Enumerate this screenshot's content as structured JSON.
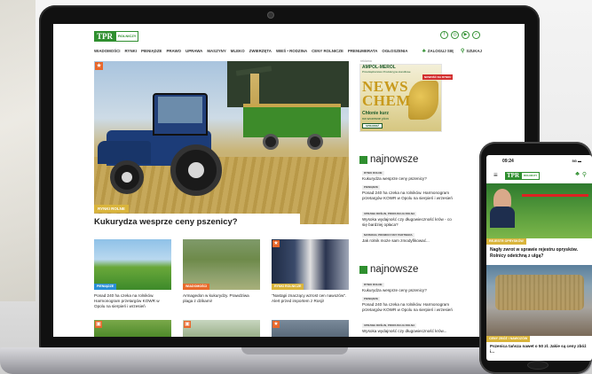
{
  "site": {
    "logo_main": "TPR",
    "logo_sub": "ROLNICZY",
    "socials": [
      "f",
      "◎",
      "▶",
      "✓"
    ],
    "nav": [
      "WIADOMOŚCI",
      "RYNKI",
      "PIENIĄDZE",
      "PRAWO",
      "UPRAWA",
      "MASZYNY",
      "MLEKO",
      "ZWIERZĘTA",
      "WIEŚ • RODZINA",
      "CENY ROLNICZE",
      "PRENUMERATA",
      "OGŁOSZENIA"
    ],
    "login_label": "ZALOGUJ SIĘ",
    "search_label": "SZUKAJ"
  },
  "hero": {
    "category": "RYNKI ROLNE",
    "title": "Kukurydza wesprze ceny pszenicy?"
  },
  "cards": [
    {
      "category": "PIENIĄDZE",
      "text": "Ponad 240 ha czeka na rolników. Harmonogram przetargów KOWR w Opolu na sierpień i wrzesień",
      "cat_color": "#2a8fd6"
    },
    {
      "category": "WIADOMOŚCI",
      "text": "Armagedon w kukurydzy. Prawdziwa plaga z dzikami!",
      "cat_color": "#e86a2b"
    },
    {
      "category": "RYNKI ROLNICZE",
      "text": "\"Nastąpi znaczący wzrost cen nawozów\". Alert przed importem z Rosji!",
      "cat_color": "#d9b43b"
    }
  ],
  "ad": {
    "label": "reklama",
    "brand": "AMPOL-MEROL",
    "brand_sub": "Przedsiębiorstwo Produkcyjno-Handlowe",
    "tag": "NOWOŚĆ NA RYNKU",
    "big_text": "NEWS CHEM",
    "line1": "Chłonie kurz",
    "line2": "na wczesne plon",
    "button": "SPRAWDŹ"
  },
  "najnowsze": {
    "heading": "najnowsze",
    "items": [
      {
        "tag": "RYNKI ROLNE",
        "text": "Kukurydza wesprze ceny pszenicy?"
      },
      {
        "tag": "PIENIĄDZE",
        "text": "Ponad 240 ha czeka na rolników. Harmonogram przetargów KOWR w Opolu na sierpień i wrzesień"
      },
      {
        "tag": "UPRAWA ROŚLIN, PRODUKCJA ROLNA",
        "text": "Wysoka wydajność czy długowieczność krów - co się bardziej opłaca?"
      },
      {
        "tag": "MATERIAŁ PROMOCYJNY PARTNERA",
        "text": "Jak rolnik może sam zmodyfikować..."
      }
    ],
    "heading2": "najnowsze",
    "items2": [
      {
        "tag": "RYNKI ROLNE",
        "text": "Kukurydza wesprze ceny pszenicy?"
      },
      {
        "tag": "PIENIĄDZE",
        "text": "Ponad 240 ha czeka na rolników. Harmonogram przetargów KOWR w Opolu na sierpień i wrzesień"
      },
      {
        "tag": "UPRAWA ROŚLIN, PRODUKCJA ROLNA",
        "text": "Wysoka wydajność czy długowieczność krów..."
      }
    ]
  },
  "phone": {
    "time": "09:24",
    "signal": "5G ▬",
    "category1": "REJESTR OPRYSKÓW",
    "title1": "Nagły zwrot w sprawie rejestru oprysków. Rolnicy odetchną z ulgą?",
    "category2": "CENY ZBÓŻ I NAWOZÓW",
    "text2": "Pszenica tańsza nawet o 50 zł. Jakie są ceny zbóż i..."
  }
}
